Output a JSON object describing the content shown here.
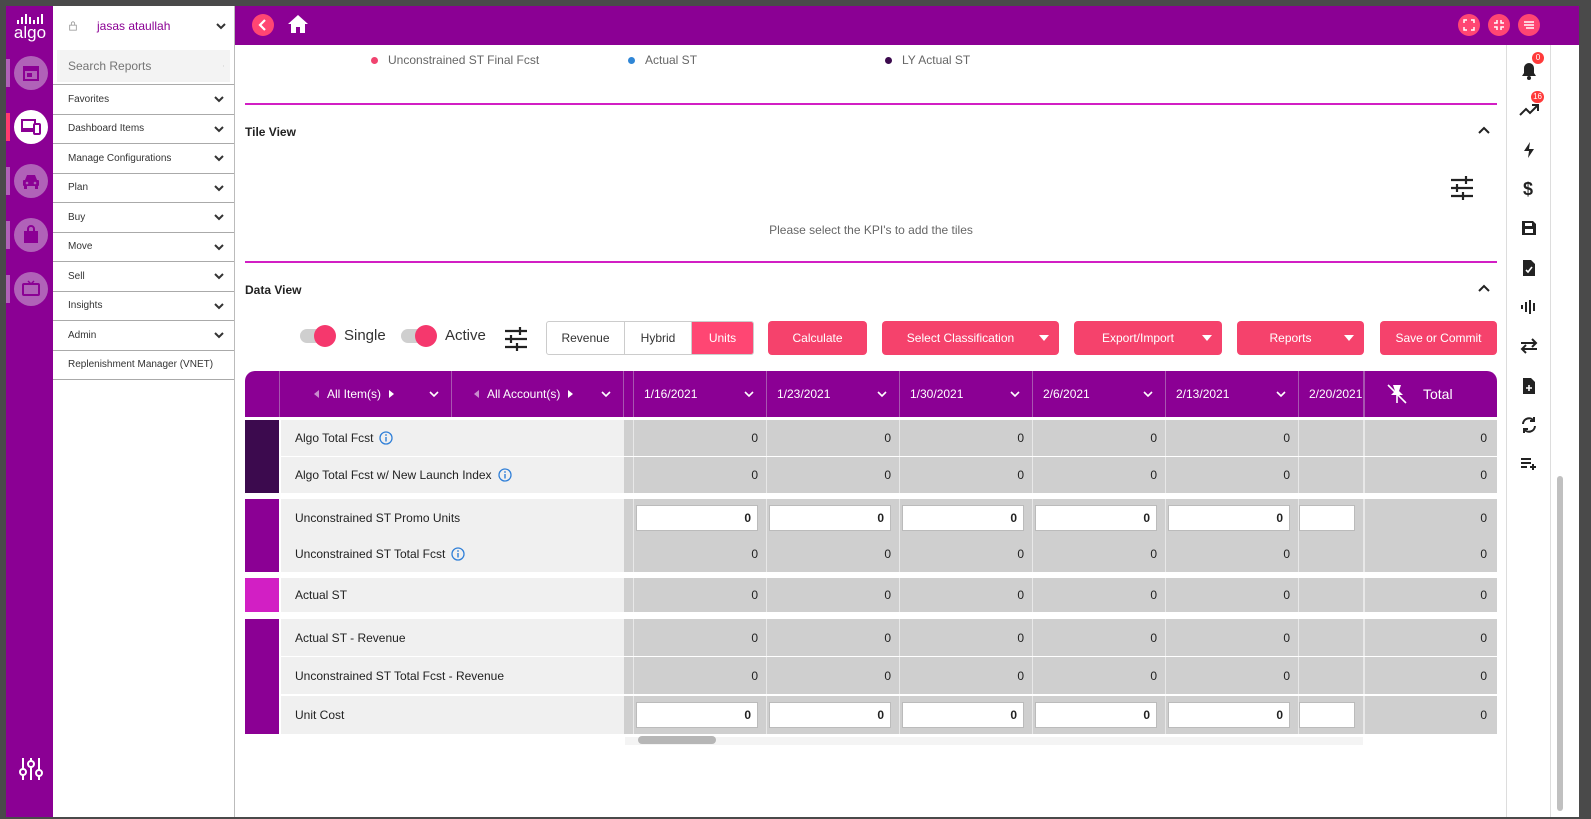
{
  "brand": {
    "logo_text": "algo",
    "primary": "#8b0094",
    "accent": "#f5426c"
  },
  "rail": {
    "icons": [
      "store-icon",
      "devices-icon",
      "car-icon",
      "shopping-bag-icon",
      "tv-icon",
      "settings-sliders-icon"
    ]
  },
  "sidebar": {
    "user_name": "jasas ataullah",
    "search_placeholder": "Search Reports",
    "items": [
      {
        "label": "Favorites"
      },
      {
        "label": "Dashboard Items"
      },
      {
        "label": "Manage Configurations"
      },
      {
        "label": "Plan"
      },
      {
        "label": "Buy"
      },
      {
        "label": "Move"
      },
      {
        "label": "Sell"
      },
      {
        "label": "Insights"
      },
      {
        "label": "Admin"
      },
      {
        "label": "Replenishment Manager (VNET)"
      }
    ]
  },
  "right_rail": {
    "notification_badge": "0",
    "trend_badge": "16"
  },
  "legend": [
    {
      "label": "Unconstrained ST Final Fcst",
      "color": "#f0436f"
    },
    {
      "label": "Actual ST",
      "color": "#2f86d6"
    },
    {
      "label": "LY Actual ST",
      "color": "#3c0a4e"
    }
  ],
  "tile_view": {
    "title": "Tile View",
    "empty_message": "Please select the KPI's to add the tiles"
  },
  "data_view": {
    "title": "Data View",
    "toggles": {
      "single": "Single",
      "active": "Active"
    },
    "measure_tabs": [
      "Revenue",
      "Hybrid",
      "Units"
    ],
    "selected_measure": "Units",
    "buttons": {
      "calculate": "Calculate",
      "select_classification": "Select Classification",
      "export_import": "Export/Import",
      "reports": "Reports",
      "save_commit": "Save or Commit"
    }
  },
  "grid": {
    "dim_headers": [
      "All Item(s)",
      "All Account(s)"
    ],
    "date_headers": [
      "1/16/2021",
      "1/23/2021",
      "1/30/2021",
      "2/6/2021",
      "2/13/2021",
      "2/20/2021"
    ],
    "total_header": "Total",
    "rows": [
      {
        "label": "Algo Total Fcst",
        "info": true,
        "editable": false,
        "values": [
          "0",
          "0",
          "0",
          "0",
          "0",
          ""
        ],
        "total": "0"
      },
      {
        "label": "Algo Total Fcst w/ New Launch Index",
        "info": true,
        "editable": false,
        "values": [
          "0",
          "0",
          "0",
          "0",
          "0",
          ""
        ],
        "total": "0"
      },
      {
        "label": "Unconstrained ST Promo Units",
        "info": false,
        "editable": true,
        "values": [
          "0",
          "0",
          "0",
          "0",
          "0",
          ""
        ],
        "total": "0"
      },
      {
        "label": "Unconstrained ST Total Fcst",
        "info": true,
        "editable": false,
        "values": [
          "0",
          "0",
          "0",
          "0",
          "0",
          ""
        ],
        "total": "0"
      },
      {
        "label": "Actual ST",
        "info": false,
        "editable": false,
        "values": [
          "0",
          "0",
          "0",
          "0",
          "0",
          ""
        ],
        "total": "0"
      },
      {
        "label": "Actual ST - Revenue",
        "info": false,
        "editable": false,
        "values": [
          "0",
          "0",
          "0",
          "0",
          "0",
          ""
        ],
        "total": "0"
      },
      {
        "label": "Unconstrained ST Total Fcst - Revenue",
        "info": false,
        "editable": false,
        "values": [
          "0",
          "0",
          "0",
          "0",
          "0",
          ""
        ],
        "total": "0"
      },
      {
        "label": "Unit Cost",
        "info": false,
        "editable": true,
        "values": [
          "0",
          "0",
          "0",
          "0",
          "0",
          ""
        ],
        "total": "0"
      }
    ],
    "group_colors": [
      "#3c0a4e",
      "#8b0094",
      "#d21fc4",
      "#8b0094"
    ]
  }
}
